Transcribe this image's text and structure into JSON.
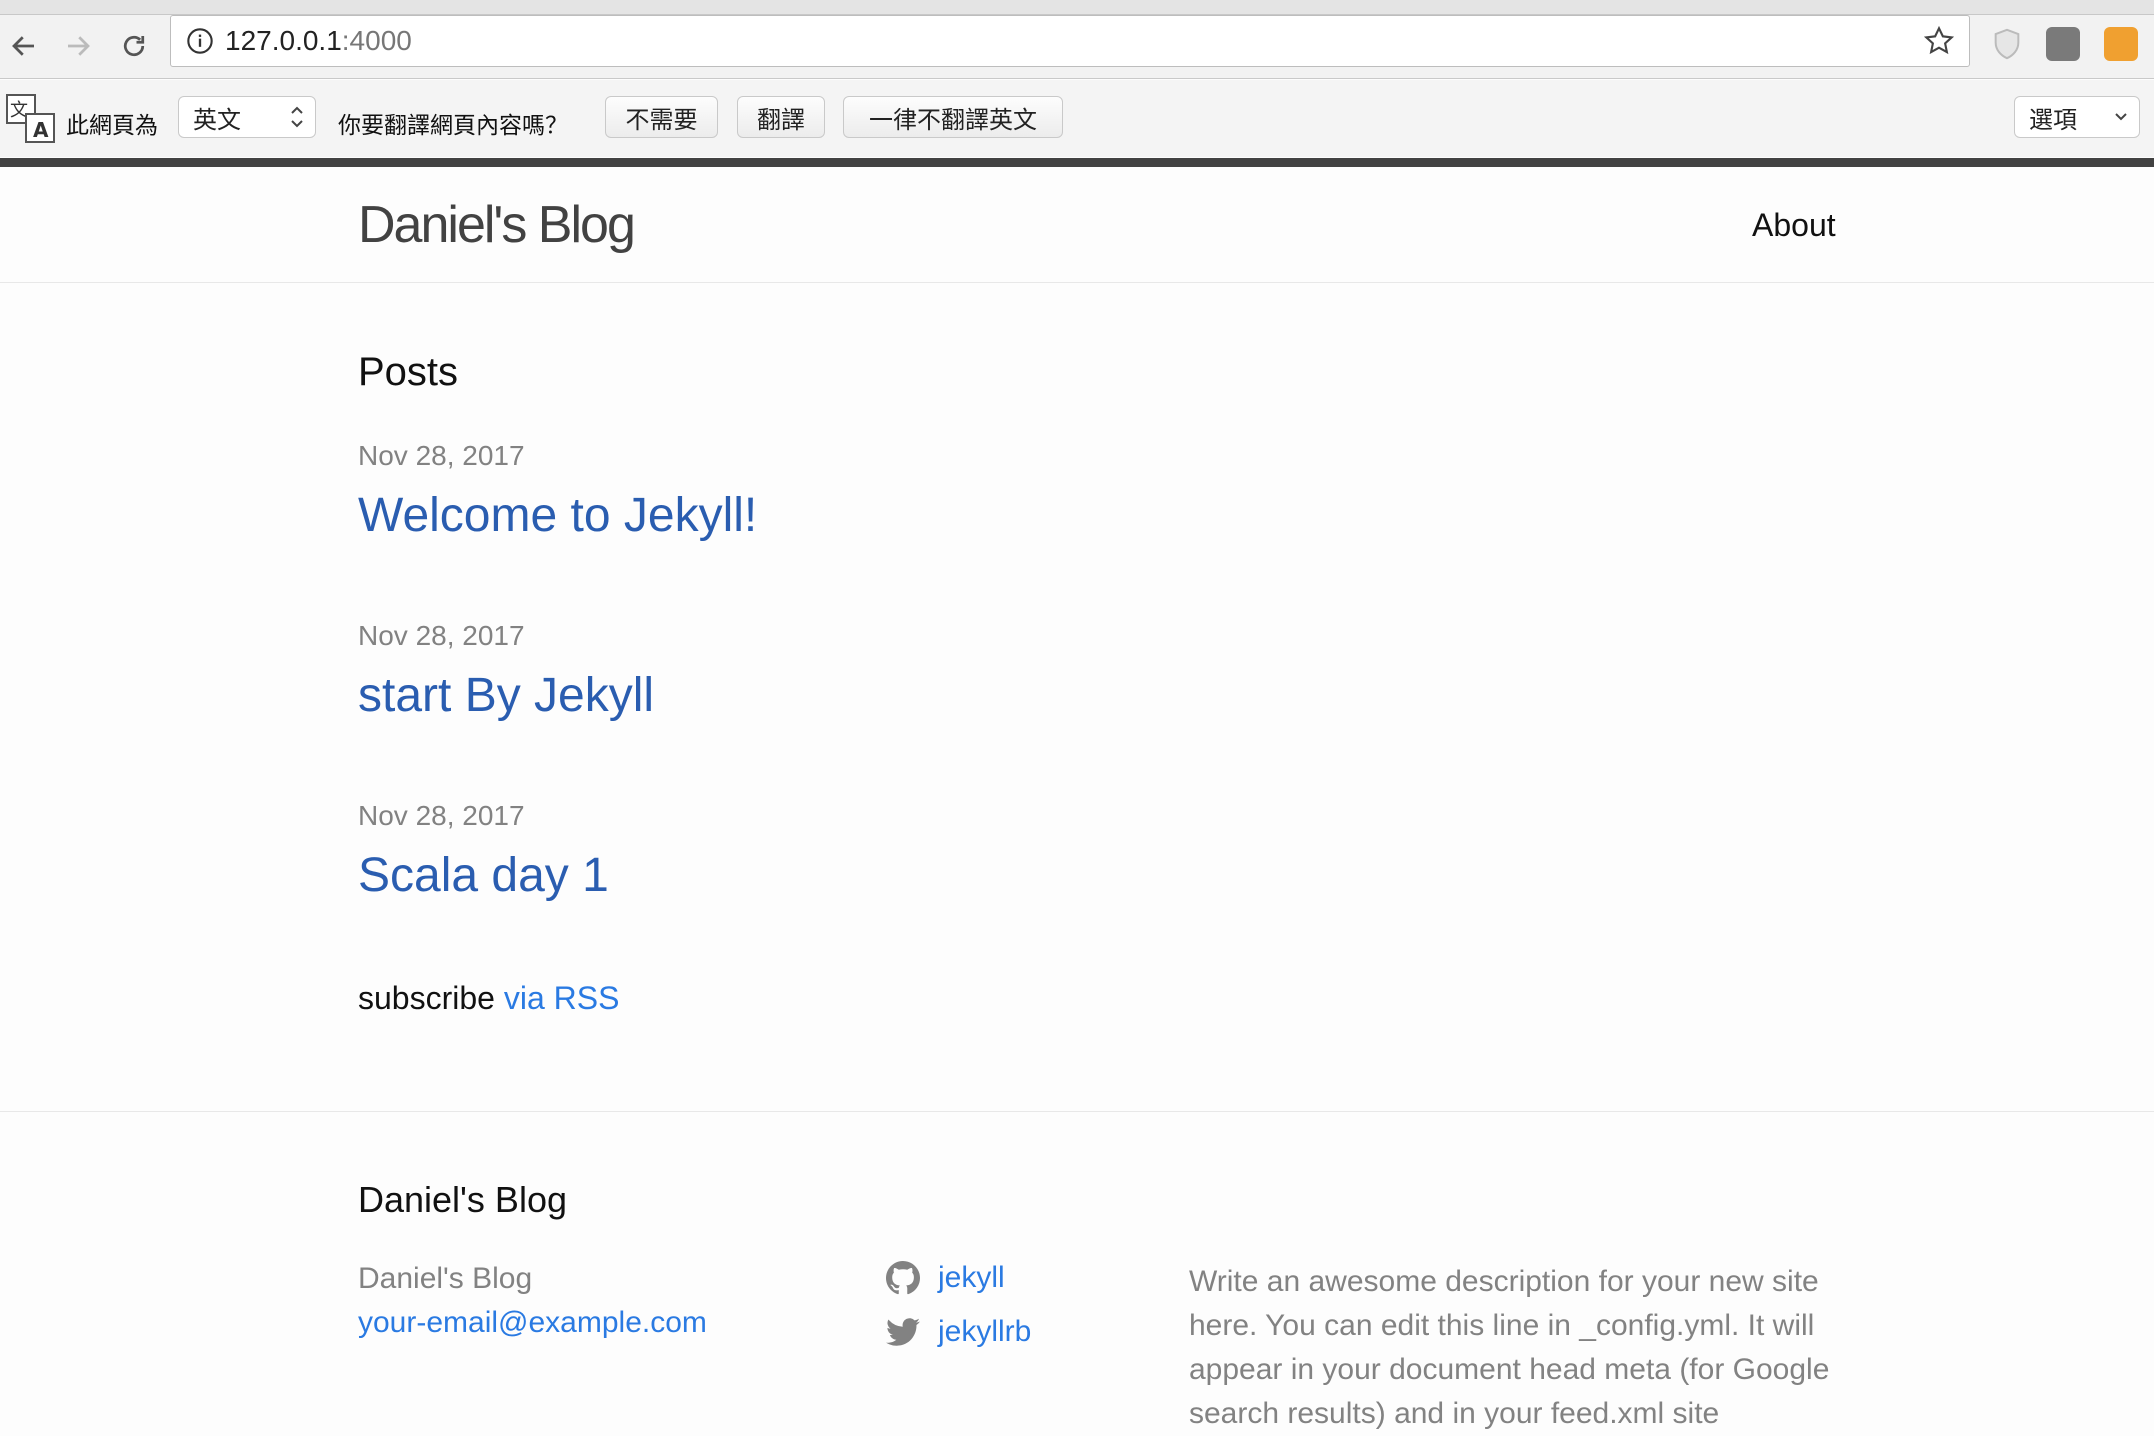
{
  "browser": {
    "url_host": "127.0.0.1",
    "url_port": ":4000"
  },
  "translate_bar": {
    "page_is_label": "此網頁為",
    "language_value": "英文",
    "question": "你要翻譯網頁內容嗎？",
    "no_button": "不需要",
    "translate_button": "翻譯",
    "never_button": "一律不翻譯英文",
    "options_label": "選項"
  },
  "header": {
    "site_title": "Daniel's Blog",
    "nav_about": "About"
  },
  "main": {
    "heading": "Posts",
    "posts": [
      {
        "date": "Nov 28, 2017",
        "title": "Welcome to Jekyll!"
      },
      {
        "date": "Nov 28, 2017",
        "title": "start By Jekyll"
      },
      {
        "date": "Nov 28, 2017",
        "title": "Scala day 1"
      }
    ],
    "subscribe_label": "subscribe",
    "rss_link": "via RSS"
  },
  "footer": {
    "heading": "Daniel's Blog",
    "name": "Daniel's Blog",
    "email": "your-email@example.com",
    "github_user": "jekyll",
    "twitter_user": "jekyllrb",
    "description": "Write an awesome description for your new site here. You can edit this line in _config.yml. It will appear in your document head meta (for Google search results) and in your feed.xml site"
  },
  "colors": {
    "link": "#2a7ae2",
    "post_link": "#2a5db0",
    "meta": "#828282"
  }
}
